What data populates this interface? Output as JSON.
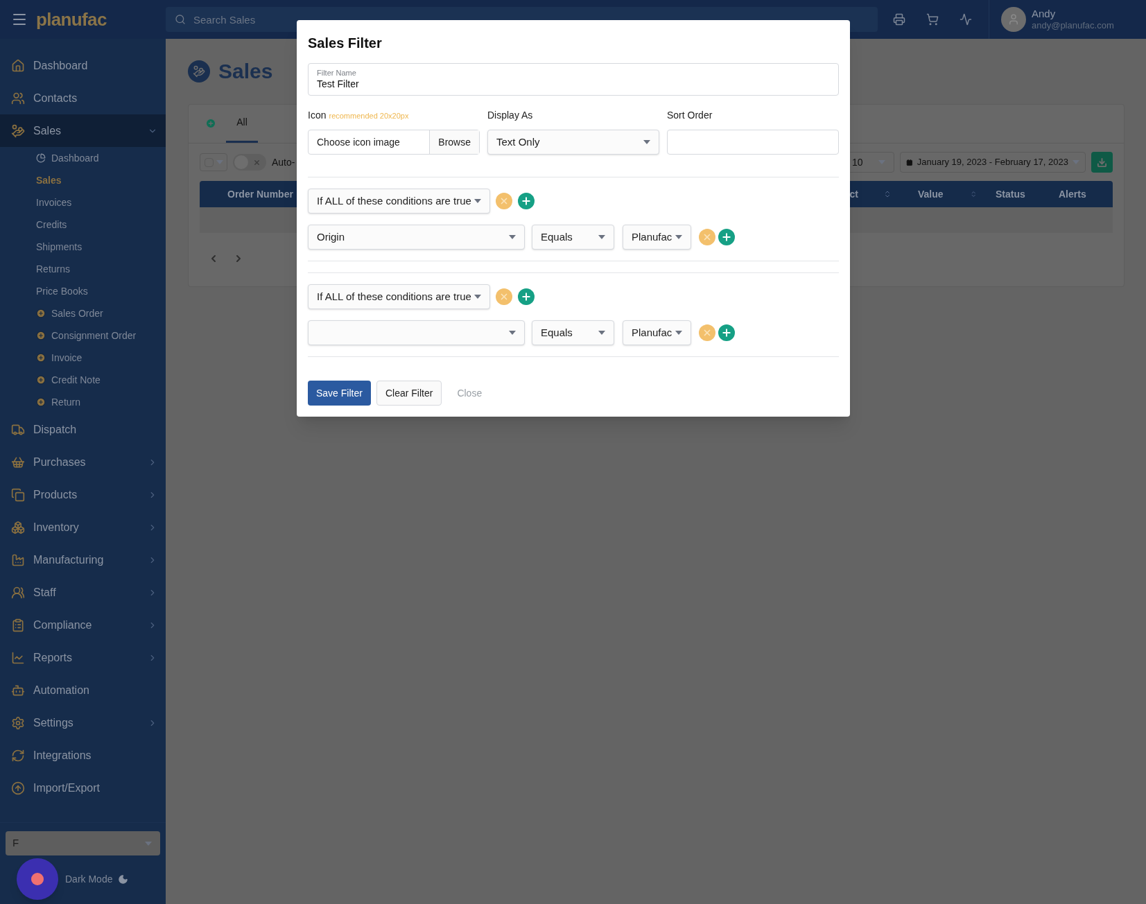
{
  "topbar": {
    "app_name": "planufac",
    "search_placeholder": "Search Sales",
    "user": {
      "name": "Andy",
      "email": "andy@planufac.com"
    }
  },
  "sidebar": {
    "items": [
      {
        "label": "Dashboard",
        "expandable": false,
        "expanded": false
      },
      {
        "label": "Contacts",
        "expandable": false,
        "expanded": false
      },
      {
        "label": "Sales",
        "expandable": true,
        "expanded": true,
        "children": [
          {
            "label": "Dashboard",
            "kind": "link",
            "selected": false
          },
          {
            "label": "Sales",
            "kind": "link",
            "selected": true
          },
          {
            "label": "Invoices",
            "kind": "link",
            "selected": false
          },
          {
            "label": "Credits",
            "kind": "link",
            "selected": false
          },
          {
            "label": "Shipments",
            "kind": "link",
            "selected": false
          },
          {
            "label": "Returns",
            "kind": "link",
            "selected": false
          },
          {
            "label": "Price Books",
            "kind": "link",
            "selected": false
          },
          {
            "label": "Sales Order",
            "kind": "create",
            "selected": false
          },
          {
            "label": "Consignment Order",
            "kind": "create",
            "selected": false
          },
          {
            "label": "Invoice",
            "kind": "create",
            "selected": false
          },
          {
            "label": "Credit Note",
            "kind": "create",
            "selected": false
          },
          {
            "label": "Return",
            "kind": "create",
            "selected": false
          }
        ]
      },
      {
        "label": "Dispatch",
        "expandable": false,
        "expanded": false
      },
      {
        "label": "Purchases",
        "expandable": true,
        "expanded": false
      },
      {
        "label": "Products",
        "expandable": true,
        "expanded": false
      },
      {
        "label": "Inventory",
        "expandable": true,
        "expanded": false
      },
      {
        "label": "Manufacturing",
        "expandable": true,
        "expanded": false
      },
      {
        "label": "Staff",
        "expandable": true,
        "expanded": false
      },
      {
        "label": "Compliance",
        "expandable": true,
        "expanded": false
      },
      {
        "label": "Reports",
        "expandable": true,
        "expanded": false
      },
      {
        "label": "Automation",
        "expandable": false,
        "expanded": false
      },
      {
        "label": "Settings",
        "expandable": true,
        "expanded": false
      },
      {
        "label": "Integrations",
        "expandable": false,
        "expanded": false
      },
      {
        "label": "Import/Export",
        "expandable": false,
        "expanded": false
      }
    ],
    "bottom_select": "F",
    "dark_mode_label": "Dark Mode"
  },
  "page": {
    "title": "Sales",
    "tabs": [
      {
        "label": "All",
        "selected": true
      }
    ],
    "toolbar": {
      "auto_toggle_on": false,
      "auto_label": "Auto-",
      "page_size": "10",
      "date_range": "January 19, 2023 - February 17, 2023"
    },
    "table": {
      "columns": [
        {
          "label": "Order Number"
        },
        {
          "label": "ct",
          "sortable": true
        },
        {
          "label": "Value",
          "sortable": true
        },
        {
          "label": "Status"
        },
        {
          "label": "Alerts"
        }
      ]
    }
  },
  "modal": {
    "title": "Sales Filter",
    "filter_name": {
      "label": "Filter Name",
      "value": "Test Filter"
    },
    "icon": {
      "label": "Icon",
      "hint": "recommended 20x20px",
      "placeholder": "Choose icon image",
      "button": "Browse"
    },
    "display_as": {
      "label": "Display As",
      "value": "Text Only"
    },
    "sort_order": {
      "label": "Sort Order"
    },
    "groups": [
      {
        "match": "If ALL of these conditions are true",
        "conditions": [
          {
            "field": "Origin",
            "operator": "Equals",
            "value": "Planufac"
          }
        ]
      },
      {
        "match": "If ALL of these conditions are true",
        "conditions": [
          {
            "operator": "Equals",
            "value": "Planufac"
          }
        ]
      }
    ],
    "buttons": [
      {
        "label": "Save Filter",
        "kind": "primary"
      },
      {
        "label": "Clear Filter",
        "kind": "secondary"
      },
      {
        "label": "Close",
        "kind": "link"
      }
    ]
  }
}
